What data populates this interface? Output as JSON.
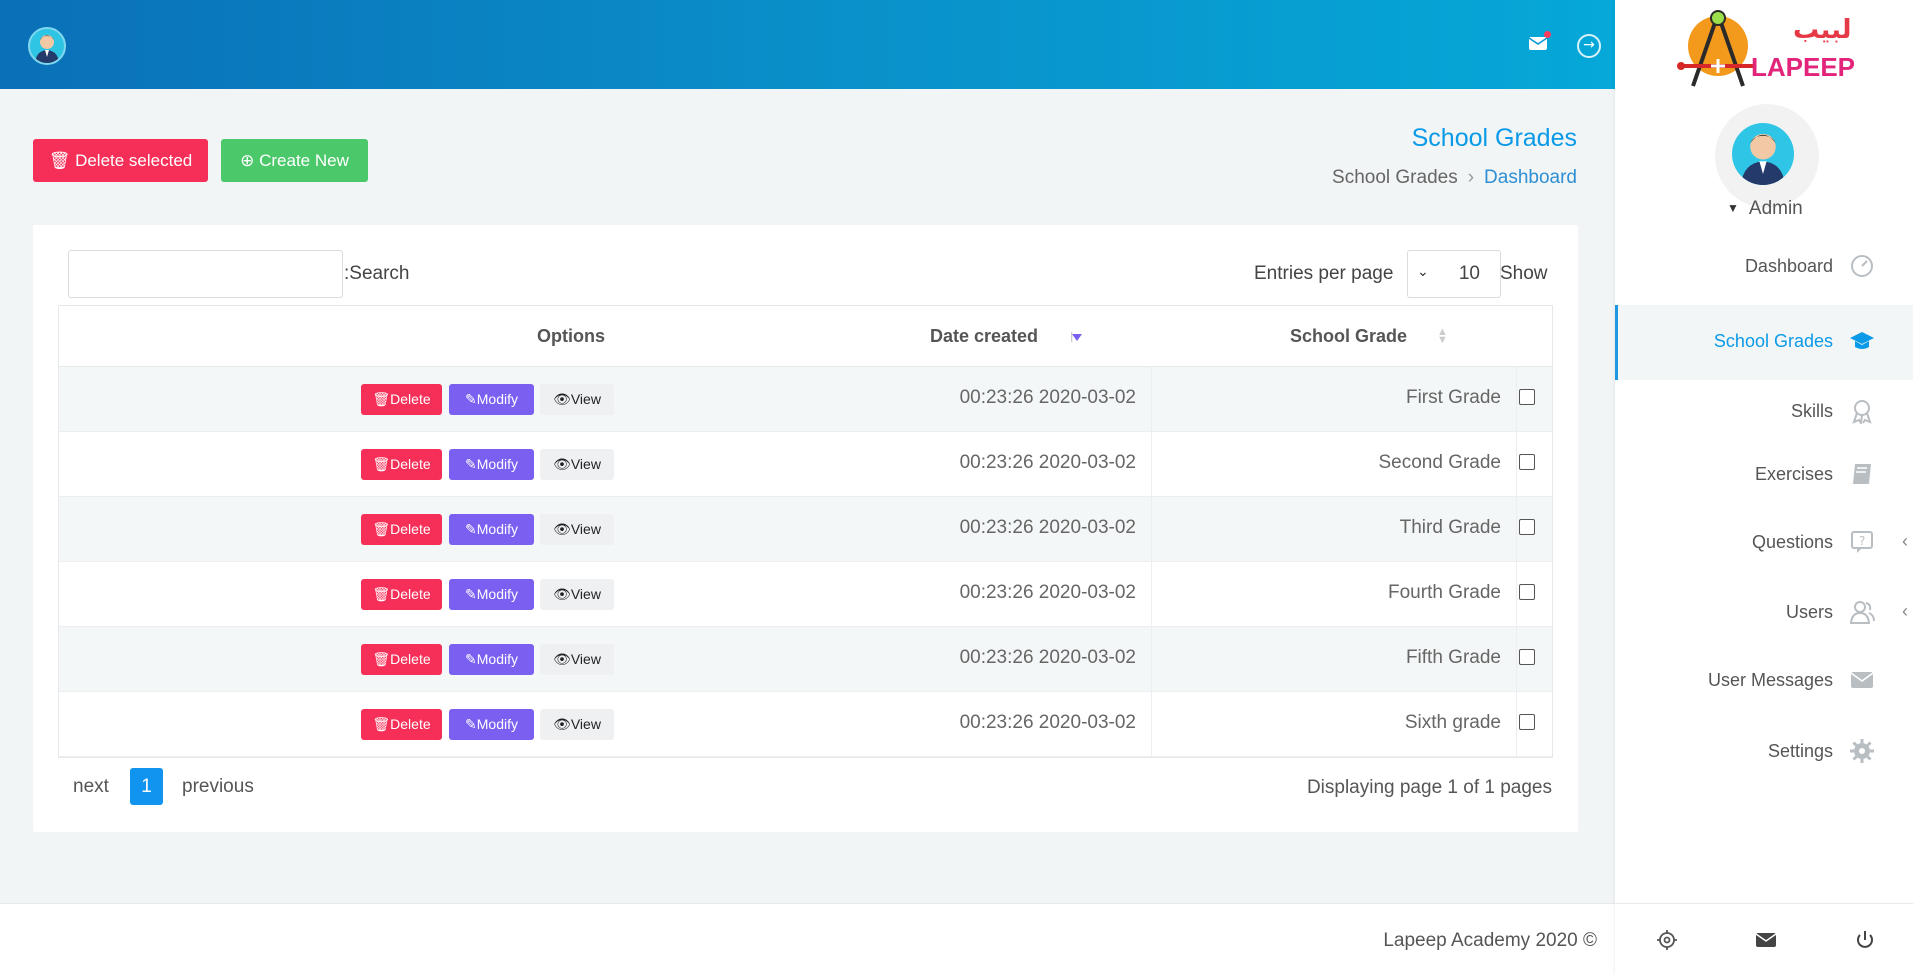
{
  "header": {
    "icons": [
      "avatar",
      "mail-icon",
      "logout-icon"
    ],
    "colors": {
      "gradient_start": "#0a70b8",
      "gradient_end": "#05a8d8"
    }
  },
  "toolbar": {
    "delete_selected_label": "Delete selected",
    "create_new_label": "Create New"
  },
  "page": {
    "title": "School Grades",
    "breadcrumb": [
      "School Grades",
      "Dashboard"
    ]
  },
  "table_controls": {
    "search_label": ":Search",
    "search_value": "",
    "entries_label": "Entries per page",
    "entries_value": "10",
    "show_label": "Show"
  },
  "table": {
    "headers": {
      "options": "Options",
      "date_created": "Date created",
      "school_grade": "School Grade"
    },
    "rows": [
      {
        "date": "00:23:26 2020-03-02",
        "grade": "First Grade",
        "delete": "Delete",
        "modify": "Modify",
        "view": "View"
      },
      {
        "date": "00:23:26 2020-03-02",
        "grade": "Second Grade",
        "delete": "Delete",
        "modify": "Modify",
        "view": "View"
      },
      {
        "date": "00:23:26 2020-03-02",
        "grade": "Third Grade",
        "delete": "Delete",
        "modify": "Modify",
        "view": "View"
      },
      {
        "date": "00:23:26 2020-03-02",
        "grade": "Fourth Grade",
        "delete": "Delete",
        "modify": "Modify",
        "view": "View"
      },
      {
        "date": "00:23:26 2020-03-02",
        "grade": "Fifth Grade",
        "delete": "Delete",
        "modify": "Modify",
        "view": "View"
      },
      {
        "date": "00:23:26 2020-03-02",
        "grade": "Sixth grade",
        "delete": "Delete",
        "modify": "Modify",
        "view": "View"
      }
    ]
  },
  "pagination": {
    "next": "next",
    "current_page": "1",
    "previous": "previous",
    "summary": "Displaying page 1 of 1 pages"
  },
  "footer": {
    "copyright": "Lapeep Academy 2020 ©"
  },
  "sidebar": {
    "logo_text": "LAPEEP",
    "logo_arabic": "لبيب",
    "user": "Admin",
    "items": [
      {
        "label": "Dashboard",
        "icon": "dashboard-icon"
      },
      {
        "label": "School Grades",
        "icon": "graduation-cap-icon",
        "active": true
      },
      {
        "label": "Skills",
        "icon": "award-icon"
      },
      {
        "label": "Exercises",
        "icon": "book-icon"
      },
      {
        "label": "Questions",
        "icon": "question-icon",
        "has_submenu": true
      },
      {
        "label": "Users",
        "icon": "users-icon",
        "has_submenu": true
      },
      {
        "label": "User Messages",
        "icon": "envelope-icon"
      },
      {
        "label": "Settings",
        "icon": "gear-icon"
      }
    ],
    "bottom_icons": [
      "settings-icon",
      "mail-icon",
      "power-icon"
    ]
  },
  "colors": {
    "accent": "#0b9ae8",
    "danger": "#f52f57",
    "success": "#4bc96a",
    "modify": "#7b5ff0"
  }
}
